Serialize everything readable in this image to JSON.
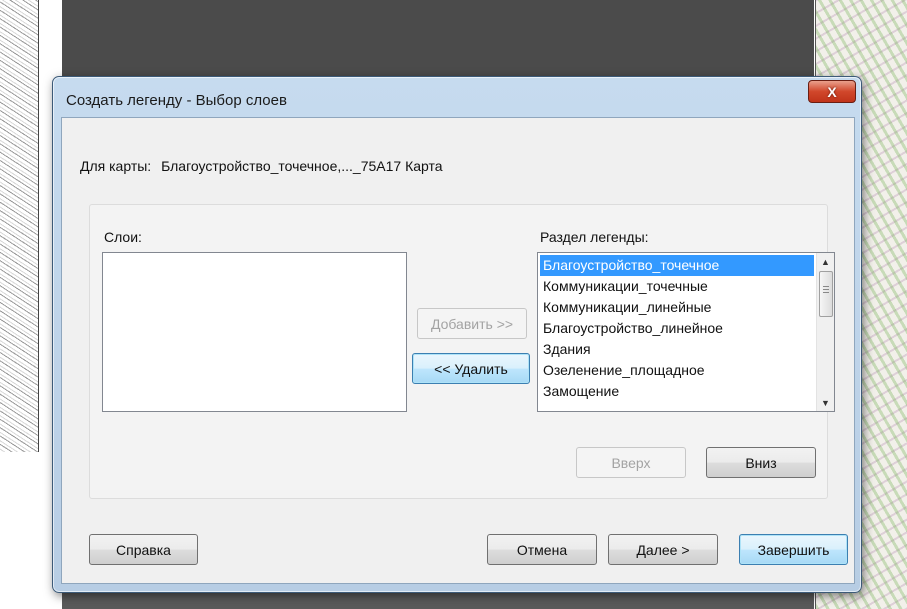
{
  "dialog": {
    "title": "Создать легенду - Выбор слоев",
    "close_label": "X"
  },
  "map_row": {
    "label": "Для карты:",
    "value": "Благоустройство_точечное,..._75A17 Карта"
  },
  "layers": {
    "label": "Слои:",
    "items": []
  },
  "legend_section": {
    "label": "Раздел легенды:",
    "items": [
      "Благоустройство_точечное",
      "Коммуникации_точечные",
      "Коммуникации_линейные",
      "Благоустройство_линейное",
      "Здания",
      "Озеленение_площадное",
      "Замощение"
    ],
    "selected_index": 0
  },
  "buttons": {
    "add": "Добавить >>",
    "remove": "<< Удалить",
    "up": "Вверх",
    "down": "Вниз",
    "help": "Справка",
    "cancel": "Отмена",
    "next": "Далее >",
    "finish": "Завершить"
  },
  "scroll_icons": {
    "up": "▲",
    "down": "▼"
  },
  "colors": {
    "selection": "#3399ff",
    "close_button": "#c0341a",
    "focus_border": "#3c7fb1"
  }
}
